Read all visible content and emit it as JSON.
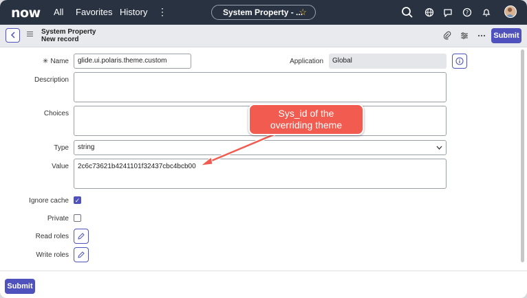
{
  "topnav": {
    "logo": "now",
    "links": [
      "All",
      "Favorites",
      "History"
    ],
    "more": "⋮",
    "context_pill": "System Property - ...",
    "icons": [
      "search-icon",
      "globe-icon",
      "chat-icon",
      "help-icon",
      "bell-icon",
      "avatar"
    ]
  },
  "header": {
    "title": "System Property",
    "subtitle": "New record",
    "submit_label": "Submit"
  },
  "form": {
    "required_mark": "✳",
    "name_label": "Name",
    "name_value": "glide.ui.polaris.theme.custom",
    "application_label": "Application",
    "application_value": "Global",
    "description_label": "Description",
    "description_value": "",
    "choices_label": "Choices",
    "choices_value": "",
    "type_label": "Type",
    "type_value": "string",
    "value_label": "Value",
    "value_value": "2c6c73621b4241101f32437cbc4bcb00",
    "ignore_cache_label": "Ignore cache",
    "ignore_cache_checked": true,
    "private_label": "Private",
    "private_checked": false,
    "read_roles_label": "Read roles",
    "write_roles_label": "Write roles"
  },
  "footer": {
    "submit_label": "Submit"
  },
  "annotation": {
    "text_line1": "Sys_id of the",
    "text_line2": "overriding theme",
    "color": "#f25b4f"
  },
  "colors": {
    "nav_bg": "#293241",
    "accent": "#4f52bd"
  }
}
